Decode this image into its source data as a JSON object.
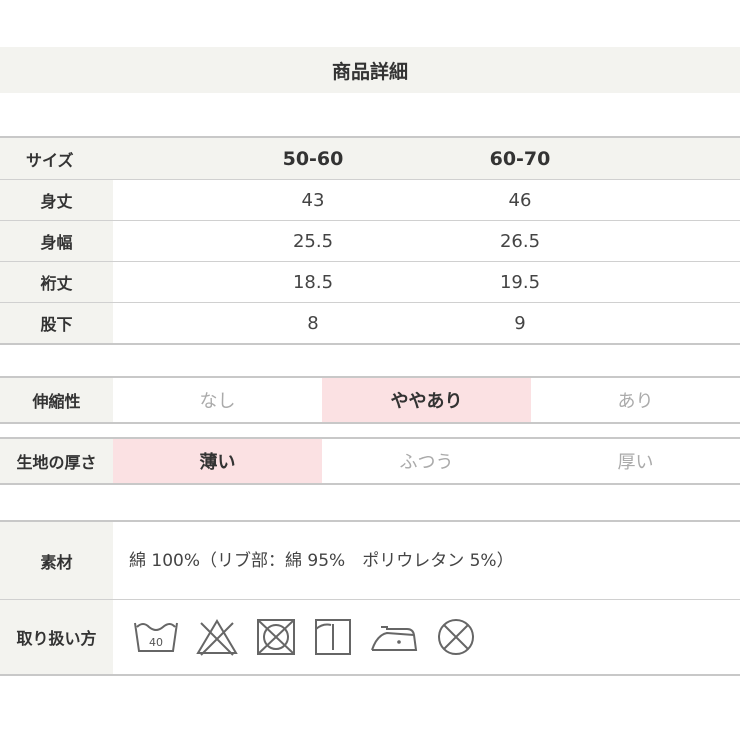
{
  "title": "商品詳細",
  "size_table": {
    "header_label": "サイズ",
    "sizes": [
      "50-60",
      "60-70"
    ],
    "rows": [
      {
        "label": "身丈",
        "values": [
          "43",
          "46"
        ]
      },
      {
        "label": "身幅",
        "values": [
          "25.5",
          "26.5"
        ]
      },
      {
        "label": "裄丈",
        "values": [
          "18.5",
          "19.5"
        ]
      },
      {
        "label": "股下",
        "values": [
          "8",
          "9"
        ]
      }
    ]
  },
  "stretch": {
    "label": "伸縮性",
    "options": [
      "なし",
      "ややあり",
      "あり"
    ],
    "selected_index": 1
  },
  "thickness": {
    "label": "生地の厚さ",
    "options": [
      "薄い",
      "ふつう",
      "厚い"
    ],
    "selected_index": 0
  },
  "material": {
    "label": "素材",
    "value": "綿 100%（リブ部：綿 95%　ポリウレタン 5%）"
  },
  "care": {
    "label": "取り扱い方",
    "icons": [
      {
        "name": "wash-40-icon",
        "text": "40"
      },
      {
        "name": "no-bleach-icon"
      },
      {
        "name": "no-tumble-dry-icon"
      },
      {
        "name": "line-dry-icon"
      },
      {
        "name": "iron-low-icon"
      },
      {
        "name": "no-dry-clean-icon"
      }
    ]
  },
  "colors": {
    "label_bg": "#f3f3ef",
    "selected_bg": "#fbe1e3",
    "border": "#c8c8c8"
  }
}
